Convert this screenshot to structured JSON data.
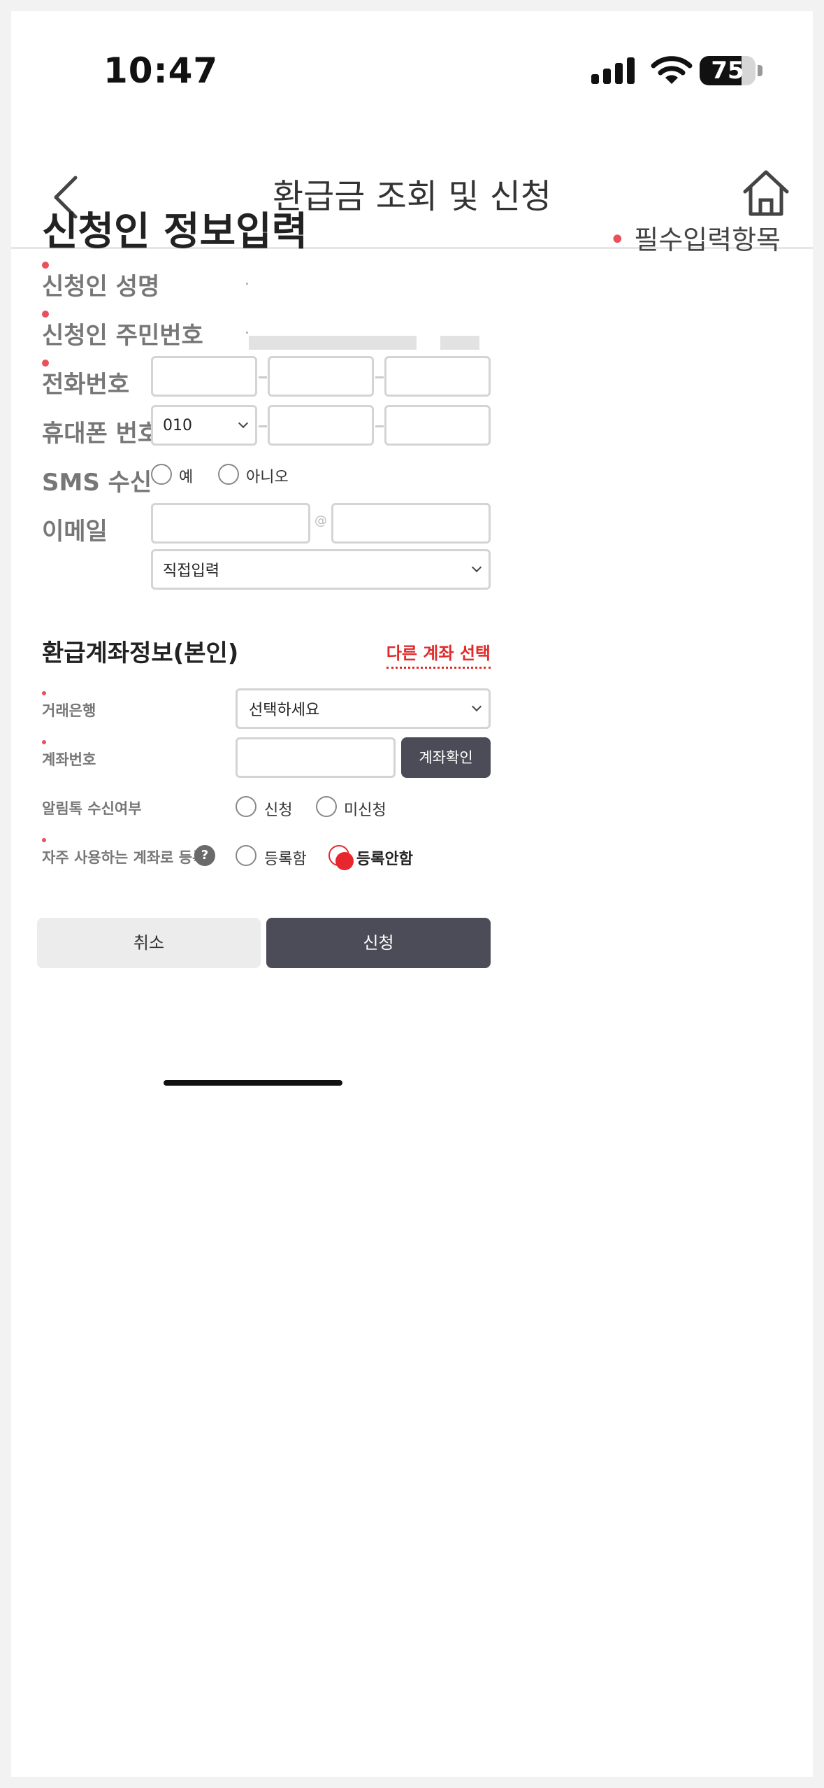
{
  "status": {
    "time": "10:47",
    "battery": "75",
    "battery_level": 0.75
  },
  "header": {
    "title": "환급금 조회 및 신청"
  },
  "applicant": {
    "section_title": "신청인 정보입력",
    "required_note": "필수입력항목",
    "name_label": "신청인 성명",
    "ssn_label": "신청인 주민번호",
    "phone_label": "전화번호",
    "mobile_label": "휴대폰 번호",
    "mobile_prefix": "010",
    "sms_label": "SMS 수신",
    "sms_yes": "예",
    "sms_no": "아니오",
    "email_label": "이메일",
    "email_at": "@",
    "email_domain_select": "직접입력"
  },
  "account": {
    "section_title": "환급계좌정보(본인)",
    "other_account": "다른 계좌 선택",
    "bank_label": "거래은행",
    "bank_select": "선택하세요",
    "acct_label": "계좌번호",
    "verify_button": "계좌확인",
    "alimtalk_label": "알림톡 수신여부",
    "alimtalk_yes": "신청",
    "alimtalk_no": "미신청",
    "favorite_label": "자주 사용하는 계좌로 등록",
    "help": "?",
    "favorite_yes": "등록함",
    "favorite_no": "등록안함"
  },
  "actions": {
    "cancel": "취소",
    "submit": "신청"
  },
  "colors": {
    "required_dot": "#e8505b",
    "accent_red": "#e02b2b",
    "dark_button": "#4c4c58",
    "light_button": "#ececec"
  }
}
